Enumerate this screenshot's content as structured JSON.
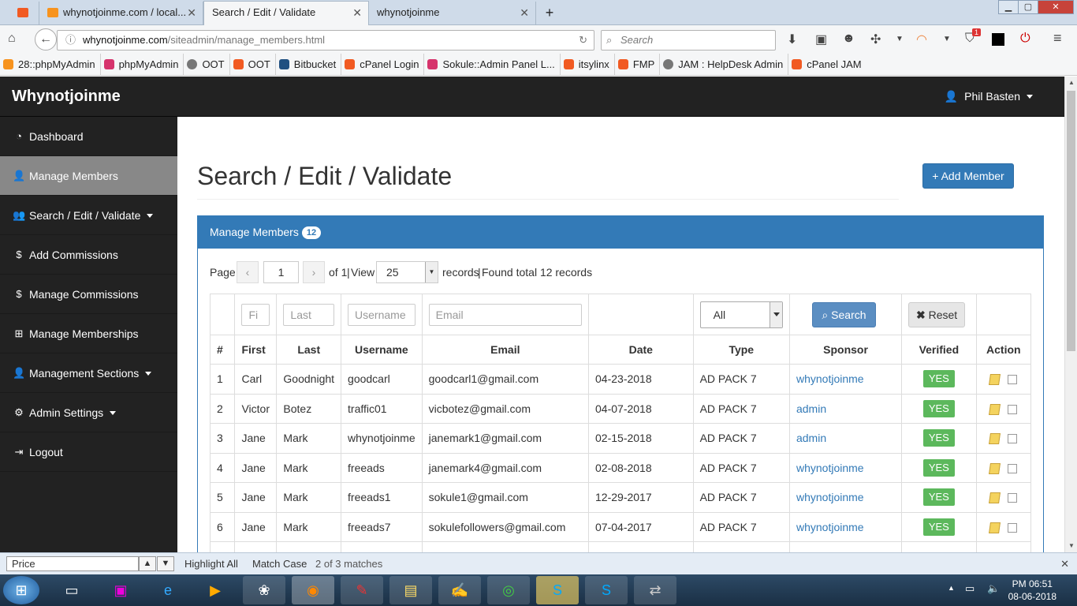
{
  "browser": {
    "tabs": [
      {
        "label": "whynotjoinme.com / local...",
        "favicon_color": "#f7931e"
      },
      {
        "label": "Search / Edit / Validate",
        "favicon_color": "#f5f6f7"
      },
      {
        "label": "whynotjoinme",
        "favicon_color": "#cfdbe9"
      }
    ],
    "url_domain": "whynotjoinme.com",
    "url_path": "/siteadmin/manage_members.html",
    "search_placeholder": "Search",
    "notification_count": "1",
    "bookmarks": [
      {
        "label": "28::phpMyAdmin",
        "color": "#f7931e"
      },
      {
        "label": "phpMyAdmin",
        "color": "#d6336c"
      },
      {
        "label": "OOT",
        "color": "#777777"
      },
      {
        "label": "OOT",
        "color": "#f15a22"
      },
      {
        "label": "Bitbucket",
        "color": "#205081"
      },
      {
        "label": "cPanel Login",
        "color": "#f15a22"
      },
      {
        "label": "Sokule::Admin Panel L...",
        "color": "#d6336c"
      },
      {
        "label": "itsylinx",
        "color": "#f15a22"
      },
      {
        "label": "FMP",
        "color": "#f15a22"
      },
      {
        "label": "JAM : HelpDesk Admin",
        "color": "#777777"
      },
      {
        "label": "cPanel JAM",
        "color": "#f15a22"
      }
    ]
  },
  "app": {
    "brand": "Whynotjoinme",
    "user_name": "Phil Basten",
    "sidebar": [
      {
        "label": "Dashboard",
        "icon": "dashboard-icon",
        "glyph": "◔",
        "caret": false,
        "active": false
      },
      {
        "label": "Manage Members",
        "icon": "user-icon",
        "glyph": "👤",
        "caret": false,
        "active": true
      },
      {
        "label": "Search / Edit / Validate",
        "icon": "users-icon",
        "glyph": "👥",
        "caret": true,
        "active": false
      },
      {
        "label": "Add Commissions",
        "icon": "dollar-icon",
        "glyph": "$",
        "caret": false,
        "active": false
      },
      {
        "label": "Manage Commissions",
        "icon": "dollar-icon",
        "glyph": "$",
        "caret": false,
        "active": false
      },
      {
        "label": "Manage Memberships",
        "icon": "sitemap-icon",
        "glyph": "⊞",
        "caret": false,
        "active": false
      },
      {
        "label": "Management Sections",
        "icon": "user-icon",
        "glyph": "👤",
        "caret": true,
        "active": false
      },
      {
        "label": "Admin Settings",
        "icon": "gear-icon",
        "glyph": "⚙",
        "caret": true,
        "active": false
      },
      {
        "label": "Logout",
        "icon": "logout-icon",
        "glyph": "⇥",
        "caret": false,
        "active": false
      }
    ],
    "page_title": "Search / Edit / Validate",
    "add_member_label": "+ Add Member",
    "panel_title": "Manage Members",
    "panel_count": "12",
    "pager": {
      "page_label": "Page",
      "prev": "‹",
      "page_value": "1",
      "next": "›",
      "of_text": "of 1",
      "view_label": "View",
      "per_page": "25",
      "records_label": "records",
      "found_text": "Found total 12 records"
    },
    "filters": {
      "first_placeholder": "Fi",
      "last_placeholder": "Last",
      "username_placeholder": "Username",
      "email_placeholder": "Email",
      "type_value": "All",
      "search_label": "Search",
      "reset_label": "Reset"
    },
    "columns": [
      "#",
      "First",
      "Last",
      "Username",
      "Email",
      "Date",
      "Type",
      "Sponsor",
      "Verified",
      "Action"
    ],
    "rows": [
      {
        "num": "1",
        "first": "Carl",
        "last": "Goodnight",
        "username": "goodcarl",
        "email": "goodcarl1@gmail.com",
        "date": "04-23-2018",
        "type": "AD PACK 7",
        "sponsor": "whynotjoinme",
        "verified": "YES"
      },
      {
        "num": "2",
        "first": "Victor",
        "last": "Botez",
        "username": "traffic01",
        "email": "vicbotez@gmail.com",
        "date": "04-07-2018",
        "type": "AD PACK 7",
        "sponsor": "admin",
        "verified": "YES"
      },
      {
        "num": "3",
        "first": "Jane",
        "last": "Mark",
        "username": "whynotjoinme",
        "email": "janemark1@gmail.com",
        "date": "02-15-2018",
        "type": "AD PACK 7",
        "sponsor": "admin",
        "verified": "YES"
      },
      {
        "num": "4",
        "first": "Jane",
        "last": "Mark",
        "username": "freeads",
        "email": "janemark4@gmail.com",
        "date": "02-08-2018",
        "type": "AD PACK 7",
        "sponsor": "whynotjoinme",
        "verified": "YES"
      },
      {
        "num": "5",
        "first": "Jane",
        "last": "Mark",
        "username": "freeads1",
        "email": "sokule1@gmail.com",
        "date": "12-29-2017",
        "type": "AD PACK 7",
        "sponsor": "whynotjoinme",
        "verified": "YES"
      },
      {
        "num": "6",
        "first": "Jane",
        "last": "Mark",
        "username": "freeads7",
        "email": "sokulefollowers@gmail.com",
        "date": "07-04-2017",
        "type": "AD PACK 7",
        "sponsor": "whynotjoinme",
        "verified": "YES"
      }
    ]
  },
  "findbar": {
    "query": "Price",
    "highlight_all": "Highlight All",
    "match_case": "Match Case",
    "status": "2 of 3 matches"
  },
  "taskbar": {
    "time": "PM 06:51",
    "date": "08-06-2018"
  }
}
